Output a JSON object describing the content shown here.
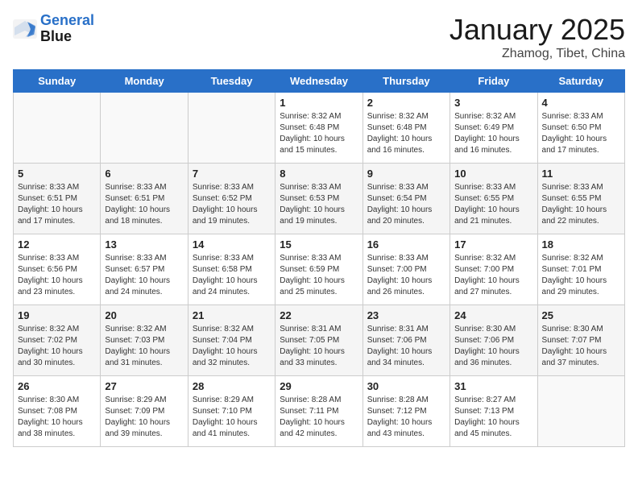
{
  "logo": {
    "line1": "General",
    "line2": "Blue"
  },
  "title": "January 2025",
  "subtitle": "Zhamog, Tibet, China",
  "days_of_week": [
    "Sunday",
    "Monday",
    "Tuesday",
    "Wednesday",
    "Thursday",
    "Friday",
    "Saturday"
  ],
  "weeks": [
    [
      {
        "day": "",
        "info": ""
      },
      {
        "day": "",
        "info": ""
      },
      {
        "day": "",
        "info": ""
      },
      {
        "day": "1",
        "info": "Sunrise: 8:32 AM\nSunset: 6:48 PM\nDaylight: 10 hours\nand 15 minutes."
      },
      {
        "day": "2",
        "info": "Sunrise: 8:32 AM\nSunset: 6:48 PM\nDaylight: 10 hours\nand 16 minutes."
      },
      {
        "day": "3",
        "info": "Sunrise: 8:32 AM\nSunset: 6:49 PM\nDaylight: 10 hours\nand 16 minutes."
      },
      {
        "day": "4",
        "info": "Sunrise: 8:33 AM\nSunset: 6:50 PM\nDaylight: 10 hours\nand 17 minutes."
      }
    ],
    [
      {
        "day": "5",
        "info": "Sunrise: 8:33 AM\nSunset: 6:51 PM\nDaylight: 10 hours\nand 17 minutes."
      },
      {
        "day": "6",
        "info": "Sunrise: 8:33 AM\nSunset: 6:51 PM\nDaylight: 10 hours\nand 18 minutes."
      },
      {
        "day": "7",
        "info": "Sunrise: 8:33 AM\nSunset: 6:52 PM\nDaylight: 10 hours\nand 19 minutes."
      },
      {
        "day": "8",
        "info": "Sunrise: 8:33 AM\nSunset: 6:53 PM\nDaylight: 10 hours\nand 19 minutes."
      },
      {
        "day": "9",
        "info": "Sunrise: 8:33 AM\nSunset: 6:54 PM\nDaylight: 10 hours\nand 20 minutes."
      },
      {
        "day": "10",
        "info": "Sunrise: 8:33 AM\nSunset: 6:55 PM\nDaylight: 10 hours\nand 21 minutes."
      },
      {
        "day": "11",
        "info": "Sunrise: 8:33 AM\nSunset: 6:55 PM\nDaylight: 10 hours\nand 22 minutes."
      }
    ],
    [
      {
        "day": "12",
        "info": "Sunrise: 8:33 AM\nSunset: 6:56 PM\nDaylight: 10 hours\nand 23 minutes."
      },
      {
        "day": "13",
        "info": "Sunrise: 8:33 AM\nSunset: 6:57 PM\nDaylight: 10 hours\nand 24 minutes."
      },
      {
        "day": "14",
        "info": "Sunrise: 8:33 AM\nSunset: 6:58 PM\nDaylight: 10 hours\nand 24 minutes."
      },
      {
        "day": "15",
        "info": "Sunrise: 8:33 AM\nSunset: 6:59 PM\nDaylight: 10 hours\nand 25 minutes."
      },
      {
        "day": "16",
        "info": "Sunrise: 8:33 AM\nSunset: 7:00 PM\nDaylight: 10 hours\nand 26 minutes."
      },
      {
        "day": "17",
        "info": "Sunrise: 8:32 AM\nSunset: 7:00 PM\nDaylight: 10 hours\nand 27 minutes."
      },
      {
        "day": "18",
        "info": "Sunrise: 8:32 AM\nSunset: 7:01 PM\nDaylight: 10 hours\nand 29 minutes."
      }
    ],
    [
      {
        "day": "19",
        "info": "Sunrise: 8:32 AM\nSunset: 7:02 PM\nDaylight: 10 hours\nand 30 minutes."
      },
      {
        "day": "20",
        "info": "Sunrise: 8:32 AM\nSunset: 7:03 PM\nDaylight: 10 hours\nand 31 minutes."
      },
      {
        "day": "21",
        "info": "Sunrise: 8:32 AM\nSunset: 7:04 PM\nDaylight: 10 hours\nand 32 minutes."
      },
      {
        "day": "22",
        "info": "Sunrise: 8:31 AM\nSunset: 7:05 PM\nDaylight: 10 hours\nand 33 minutes."
      },
      {
        "day": "23",
        "info": "Sunrise: 8:31 AM\nSunset: 7:06 PM\nDaylight: 10 hours\nand 34 minutes."
      },
      {
        "day": "24",
        "info": "Sunrise: 8:30 AM\nSunset: 7:06 PM\nDaylight: 10 hours\nand 36 minutes."
      },
      {
        "day": "25",
        "info": "Sunrise: 8:30 AM\nSunset: 7:07 PM\nDaylight: 10 hours\nand 37 minutes."
      }
    ],
    [
      {
        "day": "26",
        "info": "Sunrise: 8:30 AM\nSunset: 7:08 PM\nDaylight: 10 hours\nand 38 minutes."
      },
      {
        "day": "27",
        "info": "Sunrise: 8:29 AM\nSunset: 7:09 PM\nDaylight: 10 hours\nand 39 minutes."
      },
      {
        "day": "28",
        "info": "Sunrise: 8:29 AM\nSunset: 7:10 PM\nDaylight: 10 hours\nand 41 minutes."
      },
      {
        "day": "29",
        "info": "Sunrise: 8:28 AM\nSunset: 7:11 PM\nDaylight: 10 hours\nand 42 minutes."
      },
      {
        "day": "30",
        "info": "Sunrise: 8:28 AM\nSunset: 7:12 PM\nDaylight: 10 hours\nand 43 minutes."
      },
      {
        "day": "31",
        "info": "Sunrise: 8:27 AM\nSunset: 7:13 PM\nDaylight: 10 hours\nand 45 minutes."
      },
      {
        "day": "",
        "info": ""
      }
    ]
  ]
}
